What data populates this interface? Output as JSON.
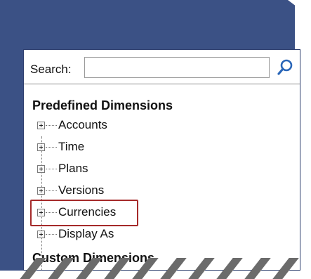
{
  "search": {
    "label": "Search:",
    "placeholder": "",
    "value": ""
  },
  "tree": {
    "groups": [
      {
        "title": "Predefined Dimensions",
        "items": [
          {
            "label": "Accounts",
            "expanded": false
          },
          {
            "label": "Time",
            "expanded": false
          },
          {
            "label": "Plans",
            "expanded": false
          },
          {
            "label": "Versions",
            "expanded": false
          },
          {
            "label": "Currencies",
            "expanded": false,
            "highlighted": true
          },
          {
            "label": "Display As",
            "expanded": false
          }
        ]
      },
      {
        "title": "Custom Dimensions"
      }
    ]
  },
  "colors": {
    "frame": "#3b5185",
    "panel": "#ffffff",
    "highlight_border": "#a52a2a"
  },
  "icons": {
    "search": "search-icon",
    "expand": "plus-box-icon"
  }
}
